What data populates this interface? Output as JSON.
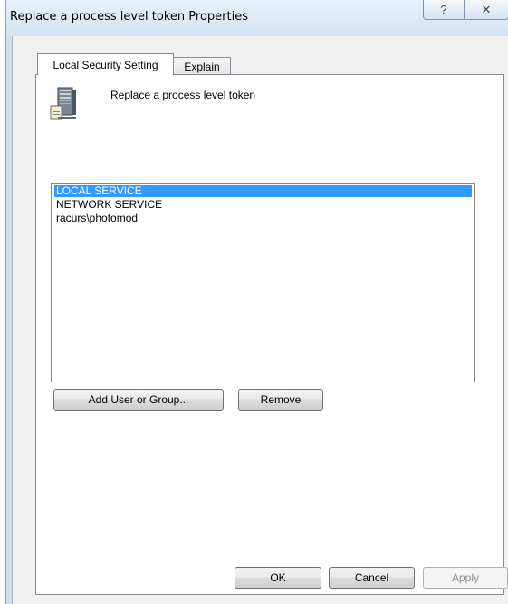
{
  "window": {
    "title": "Replace a process level token Properties",
    "caption_buttons": {
      "help_glyph": "?",
      "close_glyph": "✕"
    }
  },
  "tabs": [
    {
      "label": "Local Security Setting",
      "active": true
    },
    {
      "label": "Explain",
      "active": false
    }
  ],
  "policy": {
    "icon": "server-computer-icon",
    "title": "Replace a process level token"
  },
  "accounts": {
    "items": [
      {
        "label": "LOCAL SERVICE",
        "selected": true
      },
      {
        "label": "NETWORK SERVICE",
        "selected": false
      },
      {
        "label": "racurs\\photomod",
        "selected": false
      }
    ]
  },
  "actions": {
    "add_label": "Add User or Group...",
    "remove_label": "Remove"
  },
  "dialog_buttons": {
    "ok_label": "OK",
    "cancel_label": "Cancel",
    "apply_label": "Apply",
    "apply_enabled": false
  },
  "colors": {
    "selection": "#3399ff",
    "title_bar": "#d3e3f2",
    "disabled_text": "#8d8d8d"
  }
}
